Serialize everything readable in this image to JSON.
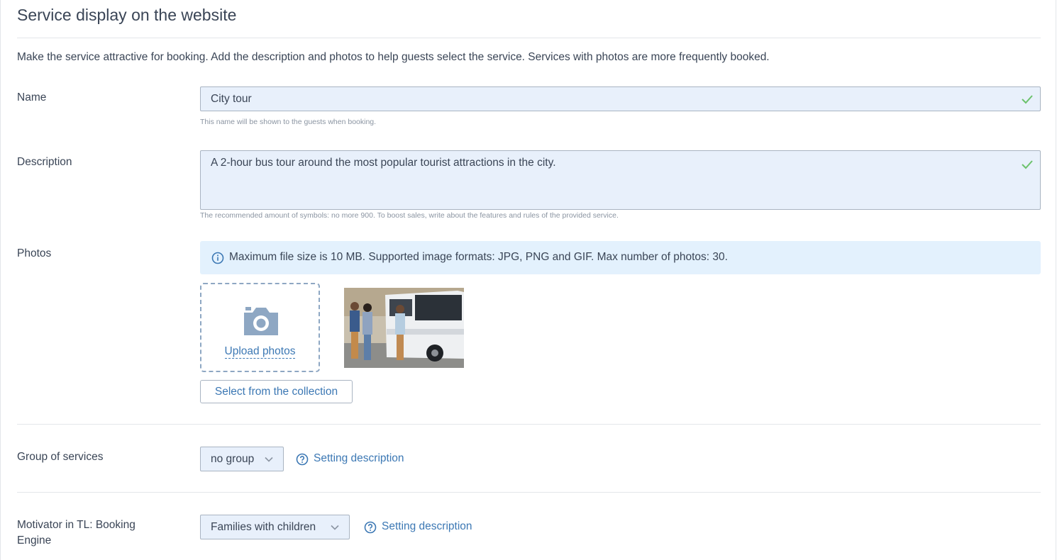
{
  "section": {
    "title": "Service display on the website",
    "intro": "Make the service attractive for booking. Add the description and photos to help guests select the service. Services with photos are more frequently booked."
  },
  "name_field": {
    "label": "Name",
    "value": "City tour",
    "hint": "This name will be shown to the guests when booking."
  },
  "description_field": {
    "label": "Description",
    "value": "A 2-hour bus tour around the most popular tourist attractions in the city.",
    "hint": "The recommended amount of symbols: no more 900. To boost sales, write about the features and rules of the provided service."
  },
  "photos": {
    "label": "Photos",
    "info": "Maximum file size is 10 MB. Supported image formats: JPG, PNG and GIF. Max number of photos: 30.",
    "upload_label": "Upload photos",
    "collection_button": "Select from the collection"
  },
  "group": {
    "label": "Group of services",
    "selected": "no group",
    "help_link": "Setting description"
  },
  "motivator": {
    "label_line1": "Motivator in TL: Booking",
    "label_line2": "Engine",
    "selected": "Families with children",
    "help_link": "Setting description"
  },
  "colors": {
    "link": "#3c78b4",
    "input_bg": "#e8f0fb",
    "info_bg": "#e3f1fd",
    "check": "#6cc26c",
    "text": "#3a4556"
  }
}
